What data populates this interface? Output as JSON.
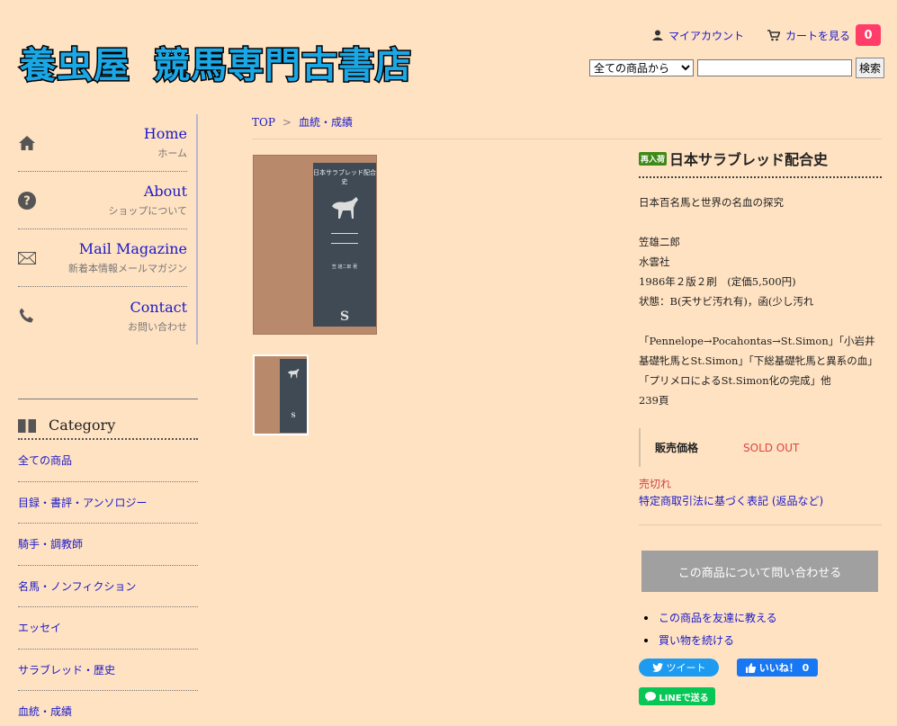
{
  "header": {
    "logo_part1": "養虫屋",
    "logo_part2": "競馬専門古書店",
    "account_label": "マイアカウント",
    "cart_label": "カートを見る",
    "cart_count": "0"
  },
  "search": {
    "select_value": "全ての商品から",
    "button_label": "検索",
    "input_value": ""
  },
  "nav": {
    "items": [
      {
        "en": "Home",
        "ja": "ホーム",
        "icon": "home-icon"
      },
      {
        "en": "About",
        "ja": "ショップについて",
        "icon": "question-icon"
      },
      {
        "en": "Mail Magazine",
        "ja": "新着本情報メールマガジン",
        "icon": "mail-icon"
      },
      {
        "en": "Contact",
        "ja": "お問い合わせ",
        "icon": "phone-icon"
      }
    ]
  },
  "category": {
    "heading": "Category",
    "items": [
      "全ての商品",
      "目録・書評・アンソロジー",
      "騎手・調教師",
      "名馬・ノンフィクション",
      "エッセイ",
      "サラブレッド・歴史",
      "血統・成績"
    ]
  },
  "breadcrumb": {
    "top": "TOP",
    "separator": ">",
    "current": "血統・成績"
  },
  "product": {
    "badge": "再入荷",
    "title": "日本サラブレッド配合史",
    "subtitle": "日本百名馬と世界の名血の探究",
    "author": "笠雄二郎",
    "publisher": "水雲社",
    "edition": "1986年２版２刷　(定価5,500円)",
    "condition": "状態：B(天サビ汚れ有)，函(少し汚れ",
    "contents": "「Pennelope→Pocahontas→St.Simon」「小岩井基礎牝馬とSt.Simon」「下総基礎牝馬と異系の血」「プリメロによるSt.Simon化の完成」他",
    "pages": "239頁",
    "price_label": "販売価格",
    "price_value": "SOLD OUT",
    "sold_text": "売切れ",
    "legal_link": "特定商取引法に基づく表記 (返品など)",
    "inquiry_button": "この商品について問い合わせる",
    "tell_friend": "この商品を友達に教える",
    "continue_shopping": "買い物を続ける",
    "tweet_label": "ツイート",
    "like_label": "いいね！ 0",
    "line_label": "LINEで送る",
    "cover_title": "日本サラブレッド配合史",
    "cover_author": "笠 雄二郎 著",
    "cover_publisher_mark": "S"
  }
}
